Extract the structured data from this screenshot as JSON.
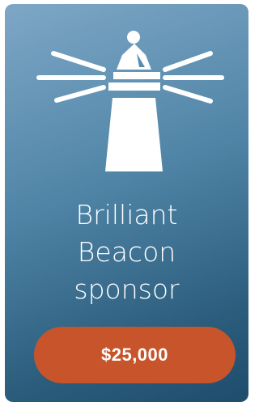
{
  "card": {
    "icon": "lighthouse-icon",
    "title_lines": [
      "Brilliant",
      "Beacon",
      "sponsor"
    ],
    "price_label": "$25,000"
  },
  "colors": {
    "card_gradient_top": "#7ea7c6",
    "card_gradient_bottom": "#1f4d6c",
    "button_bg": "#c7542b",
    "text": "#ffffff"
  }
}
